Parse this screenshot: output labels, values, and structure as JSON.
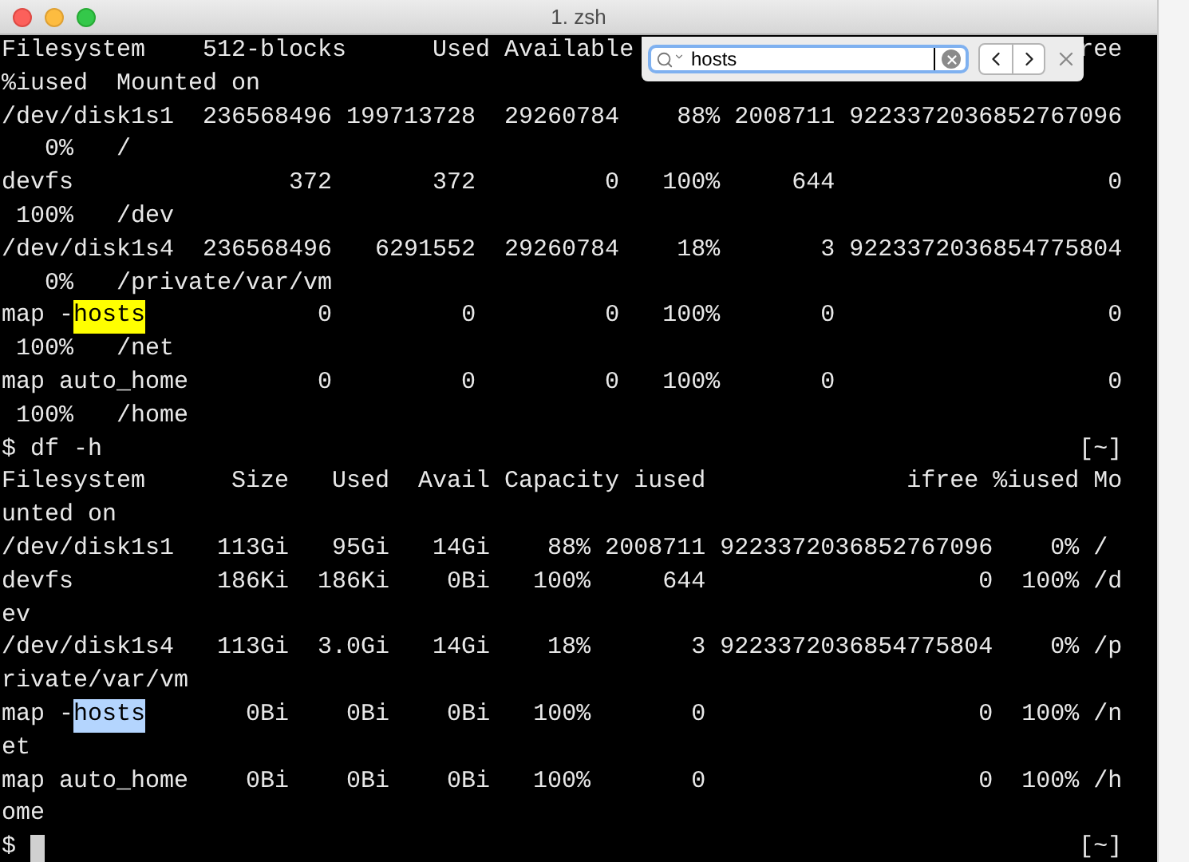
{
  "window": {
    "title": "1. zsh"
  },
  "find_bar": {
    "query": "hosts"
  },
  "lines": [
    {
      "kind": "split",
      "left": "Filesystem    512-blocks      Used Available",
      "right": "ree"
    },
    {
      "kind": "plain",
      "text": "%iused  Mounted on"
    },
    {
      "kind": "plain",
      "text": "/dev/disk1s1  236568496 199713728  29260784    88% 2008711 9223372036852767096"
    },
    {
      "kind": "plain",
      "text": "   0%   /"
    },
    {
      "kind": "plain",
      "text": "devfs               372       372         0   100%     644                   0"
    },
    {
      "kind": "plain",
      "text": " 100%   /dev"
    },
    {
      "kind": "plain",
      "text": "/dev/disk1s4  236568496   6291552  29260784    18%       3 9223372036854775804"
    },
    {
      "kind": "plain",
      "text": "   0%   /private/var/vm"
    },
    {
      "kind": "match",
      "parts": [
        {
          "text": "map -",
          "kind": "plain"
        },
        {
          "text": "hosts",
          "kind": "found"
        },
        {
          "text": "            0         0         0   100%       0                   0",
          "kind": "plain"
        }
      ]
    },
    {
      "kind": "plain",
      "text": " 100%   /net"
    },
    {
      "kind": "plain",
      "text": "map auto_home         0         0         0   100%       0                   0"
    },
    {
      "kind": "plain",
      "text": " 100%   /home"
    },
    {
      "kind": "split",
      "left": "$ df -h",
      "right": "[~]"
    },
    {
      "kind": "plain",
      "text": "Filesystem      Size   Used  Avail Capacity iused              ifree %iused Mo"
    },
    {
      "kind": "plain",
      "text": "unted on"
    },
    {
      "kind": "plain",
      "text": "/dev/disk1s1   113Gi   95Gi   14Gi    88% 2008711 9223372036852767096    0% /"
    },
    {
      "kind": "plain",
      "text": "devfs          186Ki  186Ki    0Bi   100%     644                   0  100% /d"
    },
    {
      "kind": "plain",
      "text": "ev"
    },
    {
      "kind": "plain",
      "text": "/dev/disk1s4   113Gi  3.0Gi   14Gi    18%       3 9223372036854775804    0% /p"
    },
    {
      "kind": "plain",
      "text": "rivate/var/vm"
    },
    {
      "kind": "match",
      "parts": [
        {
          "text": "map -",
          "kind": "plain"
        },
        {
          "text": "hosts",
          "kind": "selected"
        },
        {
          "text": "       0Bi    0Bi    0Bi   100%       0                   0  100% /n",
          "kind": "plain"
        }
      ]
    },
    {
      "kind": "plain",
      "text": "et"
    },
    {
      "kind": "plain",
      "text": "map auto_home    0Bi    0Bi    0Bi   100%       0                   0  100% /h"
    },
    {
      "kind": "plain",
      "text": "ome"
    },
    {
      "kind": "prompt",
      "prompt": "$",
      "cursor": true,
      "right": "[~]"
    }
  ]
}
